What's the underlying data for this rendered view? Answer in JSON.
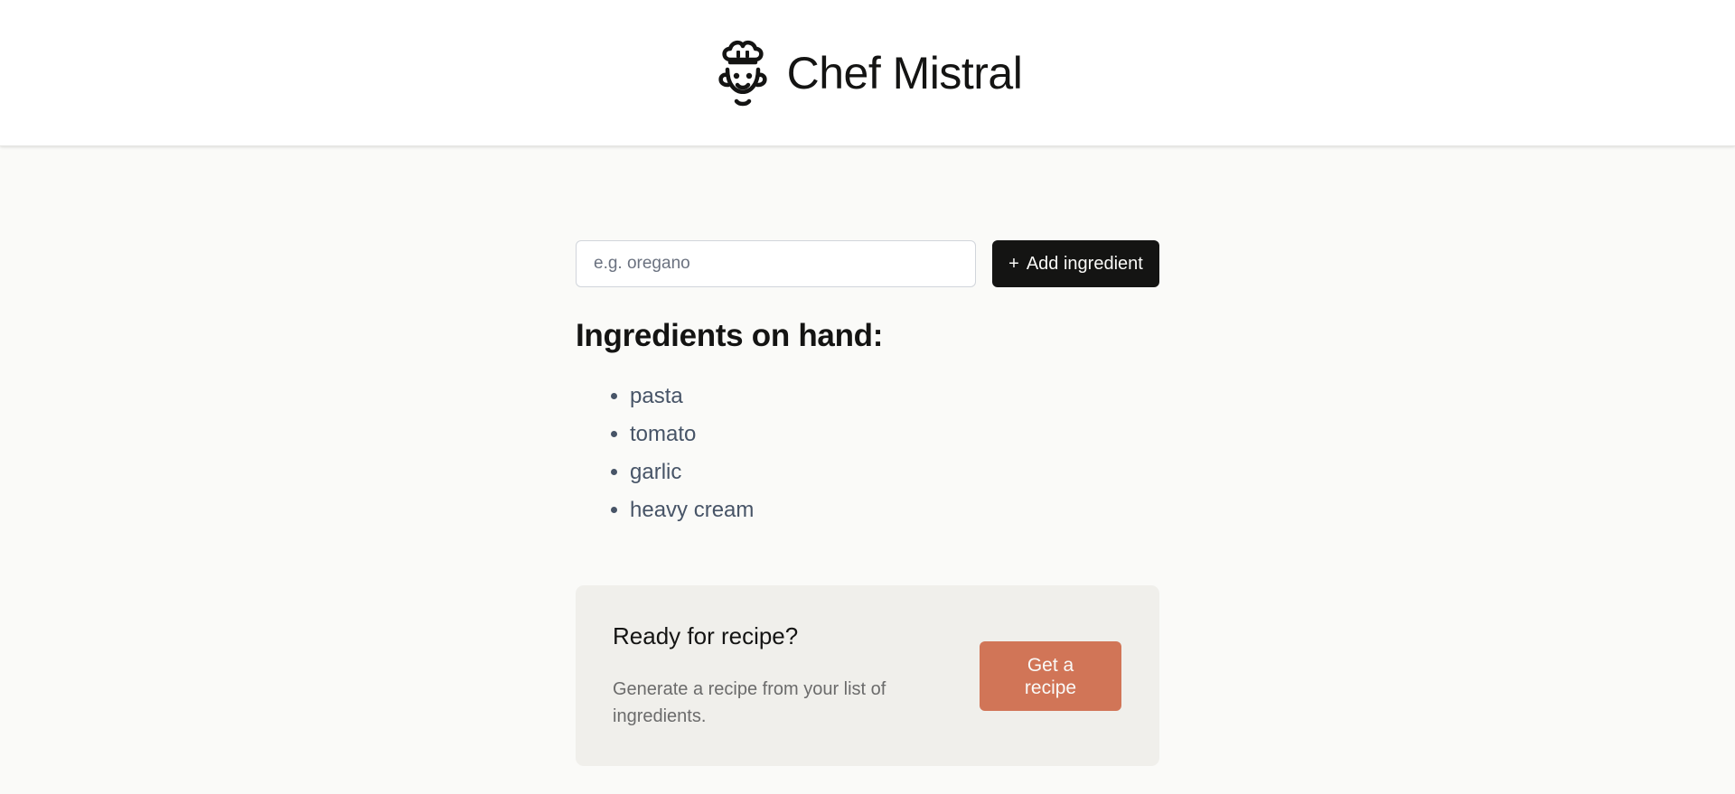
{
  "header": {
    "logo_icon": "chef-face-icon",
    "title": "Chef Mistral"
  },
  "form": {
    "placeholder": "e.g. oregano",
    "value": "",
    "button_icon": "+",
    "button_label": "Add ingredient"
  },
  "ingredients": {
    "title": "Ingredients on hand:",
    "items": [
      "pasta",
      "tomato",
      "garlic",
      "heavy cream"
    ]
  },
  "recipe_cta": {
    "title": "Ready for recipe?",
    "description": "Generate a recipe from your list of ingredients.",
    "button_label": "Get a recipe"
  },
  "colors": {
    "page_bg": "#FAFAF8",
    "header_bg": "#FFFFFF",
    "text": "#141413",
    "list_text": "#475467",
    "card_bg": "#F0EFEB",
    "accent": "#D17557"
  }
}
